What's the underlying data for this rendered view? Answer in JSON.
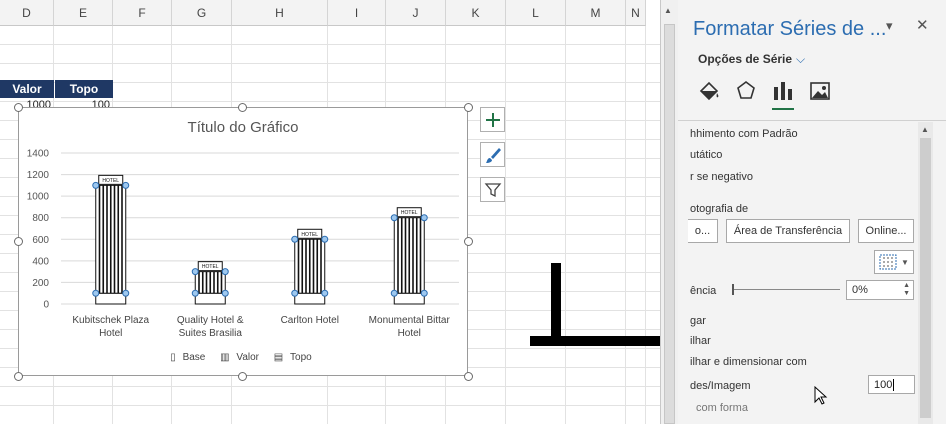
{
  "columns": [
    "D",
    "E",
    "F",
    "G",
    "H",
    "I",
    "J",
    "K",
    "L",
    "M",
    "N"
  ],
  "table": {
    "headers": [
      "Valor",
      "Topo"
    ],
    "row1": [
      "1000",
      "100"
    ]
  },
  "chart": {
    "add_element_icon": "plus-icon",
    "style_icon": "brush-icon",
    "filter_icon": "filter-icon",
    "hotel_label": "HOTEL"
  },
  "chart_data": {
    "type": "bar",
    "stacked": true,
    "title": "Título do Gráfico",
    "categories": [
      "Kubitschek Plaza|Hotel",
      "Quality Hotel &|Suites Brasilia",
      "Carlton Hotel",
      "Monumental Bittar|Hotel"
    ],
    "series": [
      {
        "name": "Base",
        "values": [
          100,
          100,
          100,
          100
        ]
      },
      {
        "name": "Valor",
        "values": [
          1000,
          200,
          500,
          700
        ]
      },
      {
        "name": "Topo",
        "values": [
          100,
          100,
          100,
          100
        ]
      }
    ],
    "yticks": [
      0,
      200,
      400,
      600,
      800,
      1000,
      1200,
      1400
    ],
    "ylim": [
      0,
      1400
    ],
    "grid": true,
    "legend": "bottom"
  },
  "pane": {
    "title": "Formatar Séries de ...",
    "series_options_label": "Opções de Série",
    "tabs": [
      "fill-line-icon",
      "effects-icon",
      "series-options-icon",
      "picture-icon"
    ],
    "options": {
      "fill_pattern": "hhimento com Padrão",
      "automatic": "utático",
      "invert_negative": "r se negativo",
      "photo_from": "otografia de",
      "insert_btn": "o...",
      "clipboard_btn": "Área de Transferência",
      "online_btn": "Online...",
      "transparency_label": "ência",
      "transparency_value": "0%",
      "stretch": "gar",
      "stack": "ilhar",
      "stack_scale": "ilhar e dimensionar com",
      "units_label": "des/Imagem",
      "units_value": "100",
      "with_shape": "com forma"
    },
    "close_icon": "close-icon",
    "menu_icon": "dropdown-icon"
  }
}
